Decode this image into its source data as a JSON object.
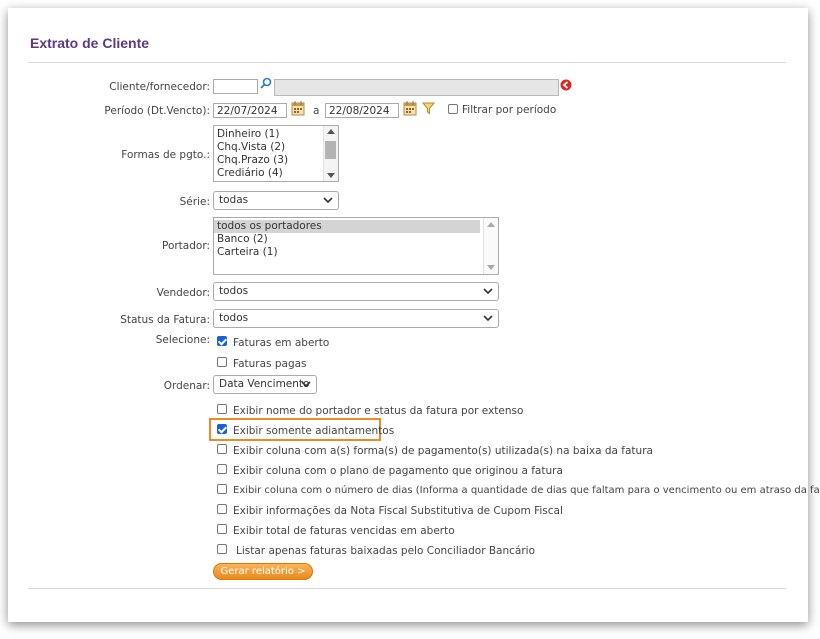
{
  "page_title": "Extrato de Cliente",
  "fields": {
    "cliente_label": "Cliente/fornecedor:",
    "cliente_value": "",
    "periodo_label": "Período (Dt.Vencto):",
    "periodo_start": "22/07/2024",
    "periodo_sep": "a",
    "periodo_end": "22/08/2024",
    "filtrar_label": "Filtrar por período",
    "formas_label": "Formas de pgto.:",
    "formas_options": [
      "Dinheiro (1)",
      "Chq.Vista (2)",
      "Chq.Prazo (3)",
      "Crediário (4)"
    ],
    "serie_label": "Série:",
    "serie_value": "todas",
    "portador_label": "Portador:",
    "portador_options": [
      "todos os portadores",
      "Banco (2)",
      "Carteira (1)"
    ],
    "vendedor_label": "Vendedor:",
    "vendedor_value": "todos",
    "status_label": "Status da Fatura:",
    "status_value": "todos",
    "selecione_label": "Selecione:",
    "faturas_aberto": "Faturas em aberto",
    "faturas_pagas": "Faturas pagas",
    "ordenar_label": "Ordenar:",
    "ordenar_value": "Data Vencimento"
  },
  "options": [
    {
      "label": "Exibir nome do portador e status da fatura por extenso",
      "checked": false
    },
    {
      "label": "Exibir somente adiantamentos",
      "checked": true
    },
    {
      "label": "Exibir coluna com a(s) forma(s) de pagamento(s) utilizada(s) na baixa da fatura",
      "checked": false
    },
    {
      "label": "Exibir coluna com o plano de pagamento que originou a fatura",
      "checked": false
    },
    {
      "label": "Exibir coluna com o número de dias (Informa a quantidade de dias que faltam para o vencimento ou em atraso da fatura)",
      "checked": false
    },
    {
      "label": "Exibir informações da Nota Fiscal Substitutiva de Cupom Fiscal",
      "checked": false
    },
    {
      "label": "Exibir total de faturas vencidas em aberto",
      "checked": false
    },
    {
      "label": "Listar apenas faturas baixadas pelo Conciliador Bancário",
      "checked": false
    }
  ],
  "button_label": "Gerar relatório >",
  "colors": {
    "title": "#5b3a80",
    "accent_orange": "#f08a24",
    "checkbox": "#1a5fd8",
    "clear_icon": "#e0261f"
  }
}
